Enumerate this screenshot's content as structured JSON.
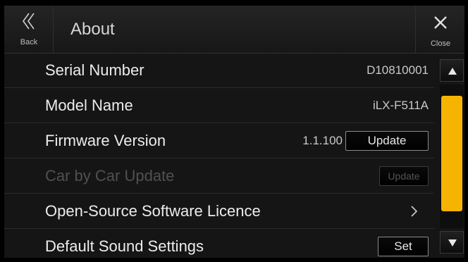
{
  "header": {
    "back_label": "Back",
    "title": "About",
    "close_label": "Close"
  },
  "rows": [
    {
      "label": "Serial Number",
      "value": "D10810001"
    },
    {
      "label": "Model Name",
      "value": "iLX-F511A"
    },
    {
      "label": "Firmware Version",
      "value": "1.1.100",
      "button": "Update"
    },
    {
      "label": "Car by Car Update",
      "button": "Update",
      "disabled": true
    },
    {
      "label": "Open-Source Software Licence",
      "icon": "chevron-right-icon"
    },
    {
      "label": "Default Sound Settings",
      "button": "Set"
    }
  ],
  "scrollbar": {
    "thumb_start_fraction": 0.08,
    "thumb_end_fraction": 0.88,
    "accent_color": "#f6b400"
  },
  "icons": [
    "back-chevrons-icon",
    "close-icon",
    "chevron-right-icon",
    "scroll-up-arrow-icon",
    "scroll-down-arrow-icon"
  ]
}
